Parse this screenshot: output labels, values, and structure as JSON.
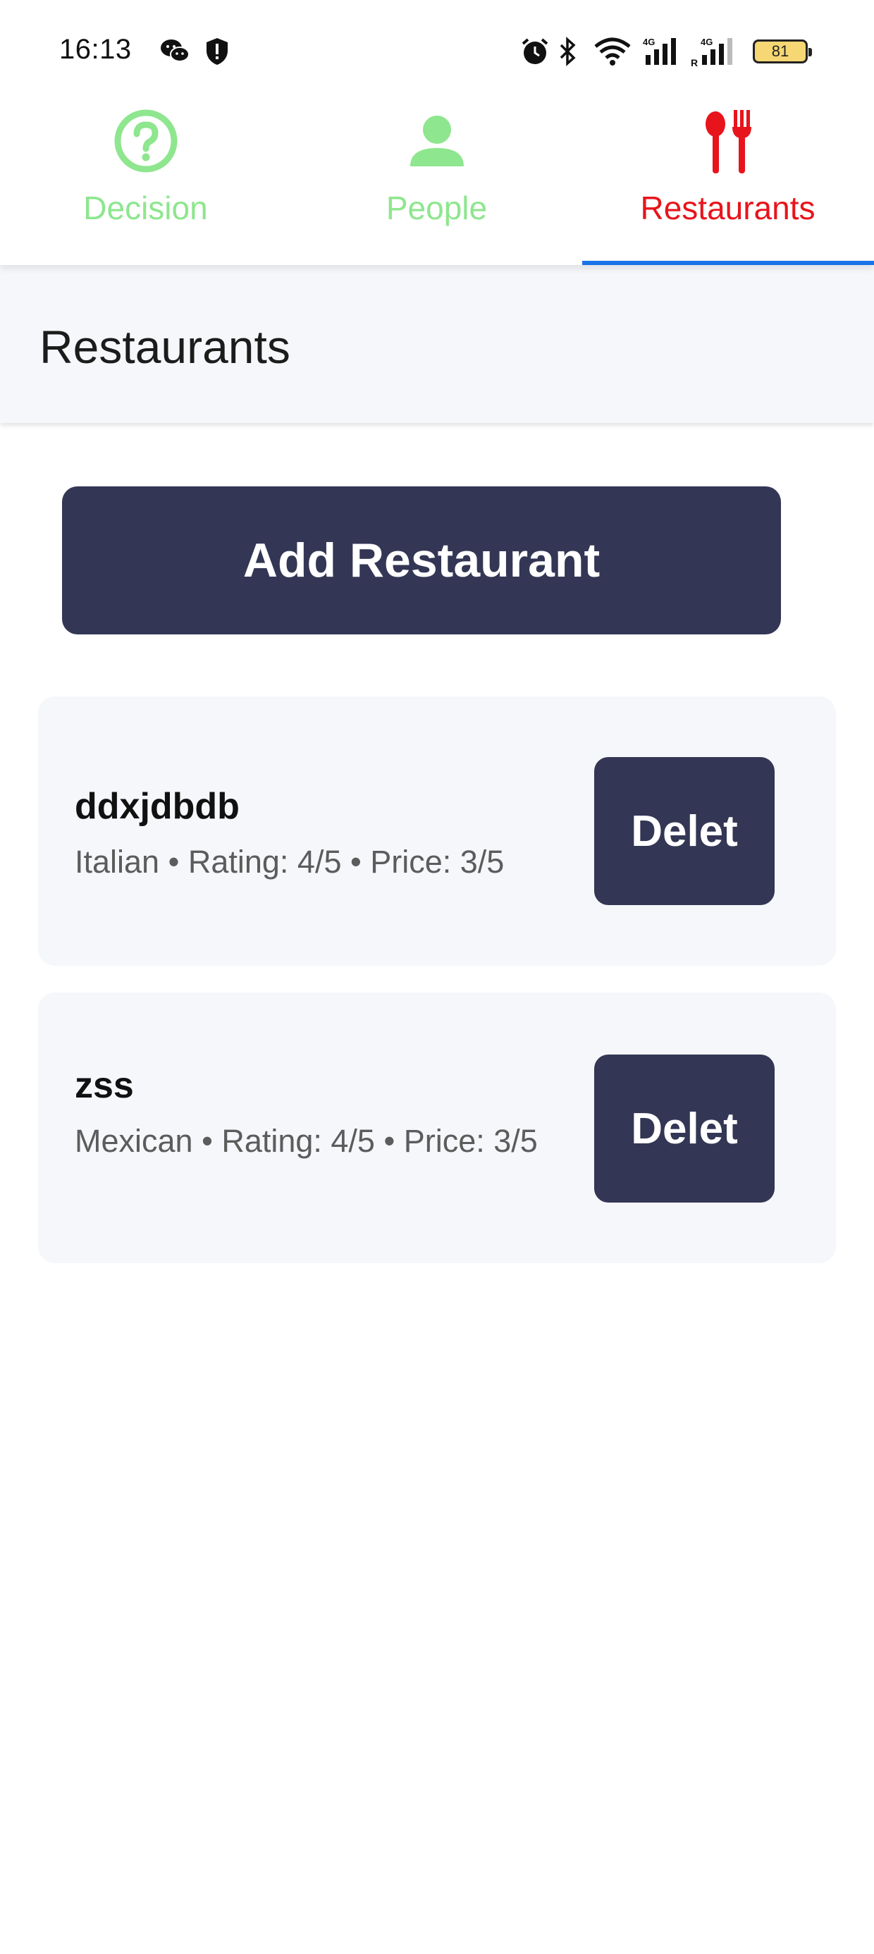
{
  "status_bar": {
    "time": "16:13",
    "battery": "81",
    "icons": [
      "wechat-icon",
      "shield-icon",
      "alarm-icon",
      "bluetooth-icon",
      "wifi-icon",
      "signal-4g-icon",
      "signal-4g-roaming-icon",
      "battery-icon"
    ]
  },
  "tabs": [
    {
      "label": "Decision",
      "icon": "question-circle-icon",
      "color": "#8ee68e",
      "active": false
    },
    {
      "label": "People",
      "icon": "person-icon",
      "color": "#8ee68e",
      "active": false
    },
    {
      "label": "Restaurants",
      "icon": "utensils-icon",
      "color": "#e8141c",
      "active": true
    }
  ],
  "header": {
    "title": "Restaurants"
  },
  "add_button": {
    "label": "Add Restaurant"
  },
  "restaurants": [
    {
      "name": "ddxjdbdb",
      "details": "Italian • Rating: 4/5 • Price: 3/5",
      "delete_label": "Delet"
    },
    {
      "name": "zss",
      "details": "Mexican • Rating: 4/5 • Price: 3/5",
      "delete_label": "Delet"
    }
  ],
  "colors": {
    "accent_blue": "#1a73e8",
    "button_bg": "#333654",
    "inactive_tab": "#8ee68e",
    "active_tab": "#e8141c"
  }
}
